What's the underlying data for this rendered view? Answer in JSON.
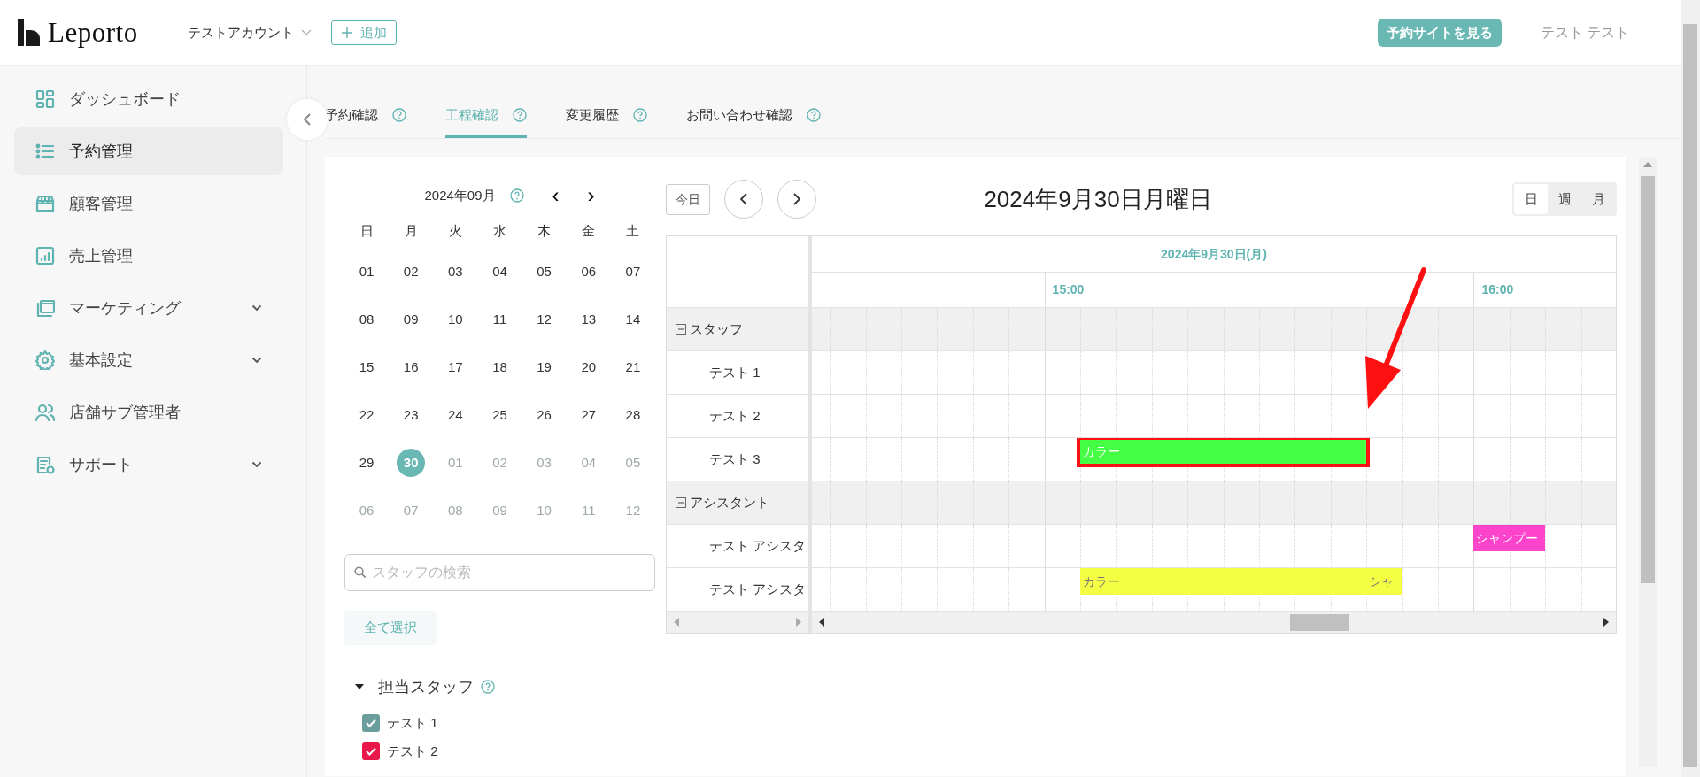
{
  "header": {
    "logo": "Leporto",
    "account": "テストアカウント",
    "add_button": "追加",
    "site_button": "予約サイトを見る",
    "user": "テスト テスト"
  },
  "sidebar": {
    "items": [
      {
        "label": "ダッシュボード",
        "selected": false,
        "expandable": false
      },
      {
        "label": "予約管理",
        "selected": true,
        "expandable": false
      },
      {
        "label": "顧客管理",
        "selected": false,
        "expandable": false
      },
      {
        "label": "売上管理",
        "selected": false,
        "expandable": false
      },
      {
        "label": "マーケティング",
        "selected": false,
        "expandable": true
      },
      {
        "label": "基本設定",
        "selected": false,
        "expandable": true
      },
      {
        "label": "店舗サブ管理者",
        "selected": false,
        "expandable": false
      },
      {
        "label": "サポート",
        "selected": false,
        "expandable": true
      }
    ]
  },
  "tabs": [
    {
      "label": "予約確認",
      "selected": false
    },
    {
      "label": "工程確認",
      "selected": true
    },
    {
      "label": "変更履歴",
      "selected": false
    },
    {
      "label": "お問い合わせ確認",
      "selected": false
    }
  ],
  "mini_calendar": {
    "month": "2024年09月",
    "prev": "‹",
    "next": "›",
    "weekdays": [
      "日",
      "月",
      "火",
      "水",
      "木",
      "金",
      "土"
    ],
    "days": [
      {
        "label": "01",
        "muted": false,
        "selected": false
      },
      {
        "label": "02",
        "muted": false,
        "selected": false
      },
      {
        "label": "03",
        "muted": false,
        "selected": false
      },
      {
        "label": "04",
        "muted": false,
        "selected": false
      },
      {
        "label": "05",
        "muted": false,
        "selected": false
      },
      {
        "label": "06",
        "muted": false,
        "selected": false
      },
      {
        "label": "07",
        "muted": false,
        "selected": false
      },
      {
        "label": "08",
        "muted": false,
        "selected": false
      },
      {
        "label": "09",
        "muted": false,
        "selected": false
      },
      {
        "label": "10",
        "muted": false,
        "selected": false
      },
      {
        "label": "11",
        "muted": false,
        "selected": false
      },
      {
        "label": "12",
        "muted": false,
        "selected": false
      },
      {
        "label": "13",
        "muted": false,
        "selected": false
      },
      {
        "label": "14",
        "muted": false,
        "selected": false
      },
      {
        "label": "15",
        "muted": false,
        "selected": false
      },
      {
        "label": "16",
        "muted": false,
        "selected": false
      },
      {
        "label": "17",
        "muted": false,
        "selected": false
      },
      {
        "label": "18",
        "muted": false,
        "selected": false
      },
      {
        "label": "19",
        "muted": false,
        "selected": false
      },
      {
        "label": "20",
        "muted": false,
        "selected": false
      },
      {
        "label": "21",
        "muted": false,
        "selected": false
      },
      {
        "label": "22",
        "muted": false,
        "selected": false
      },
      {
        "label": "23",
        "muted": false,
        "selected": false
      },
      {
        "label": "24",
        "muted": false,
        "selected": false
      },
      {
        "label": "25",
        "muted": false,
        "selected": false
      },
      {
        "label": "26",
        "muted": false,
        "selected": false
      },
      {
        "label": "27",
        "muted": false,
        "selected": false
      },
      {
        "label": "28",
        "muted": false,
        "selected": false
      },
      {
        "label": "29",
        "muted": false,
        "selected": false
      },
      {
        "label": "30",
        "muted": false,
        "selected": true
      },
      {
        "label": "01",
        "muted": true,
        "selected": false
      },
      {
        "label": "02",
        "muted": true,
        "selected": false
      },
      {
        "label": "03",
        "muted": true,
        "selected": false
      },
      {
        "label": "04",
        "muted": true,
        "selected": false
      },
      {
        "label": "05",
        "muted": true,
        "selected": false
      },
      {
        "label": "06",
        "muted": true,
        "selected": false
      },
      {
        "label": "07",
        "muted": true,
        "selected": false
      },
      {
        "label": "08",
        "muted": true,
        "selected": false
      },
      {
        "label": "09",
        "muted": true,
        "selected": false
      },
      {
        "label": "10",
        "muted": true,
        "selected": false
      },
      {
        "label": "11",
        "muted": true,
        "selected": false
      },
      {
        "label": "12",
        "muted": true,
        "selected": false
      }
    ]
  },
  "staff_search": {
    "placeholder": "スタッフの検索"
  },
  "select_all": "全て選択",
  "staff_filter": {
    "title": "担当スタッフ",
    "expanded": true,
    "items": [
      {
        "label": "テスト 1",
        "checked": true,
        "color": "#6a9e9c"
      },
      {
        "label": "テスト 2",
        "checked": true,
        "color": "#e8194a"
      }
    ]
  },
  "scheduler": {
    "today": "今日",
    "title": "2024年9月30日月曜日",
    "views": [
      {
        "label": "日",
        "selected": true
      },
      {
        "label": "週",
        "selected": false
      },
      {
        "label": "月",
        "selected": false
      }
    ],
    "date_header": "2024年9月30日(月)",
    "hours": [
      "15:00",
      "16:00"
    ],
    "groups": [
      {
        "label": "スタッフ",
        "expanded": true,
        "children": [
          {
            "label": "テスト 1"
          },
          {
            "label": "テスト 2"
          },
          {
            "label": "テスト 3",
            "events": [
              {
                "label": "カラー",
                "color": "#44ff44",
                "highlighted": true
              }
            ]
          }
        ]
      },
      {
        "label": "アシスタント",
        "expanded": true,
        "children": [
          {
            "label": "テスト アシスタ",
            "events": [
              {
                "label": "シャンプー",
                "color": "#ff44cc",
                "highlighted": false
              }
            ]
          },
          {
            "label": "テスト アシスタ",
            "events": [
              {
                "label": "カラー",
                "color": "#f4ff44",
                "highlighted": false
              },
              {
                "label": "シャ",
                "color": "#f4ff44",
                "highlighted": false
              }
            ]
          }
        ]
      }
    ]
  },
  "annotation_arrow": true
}
